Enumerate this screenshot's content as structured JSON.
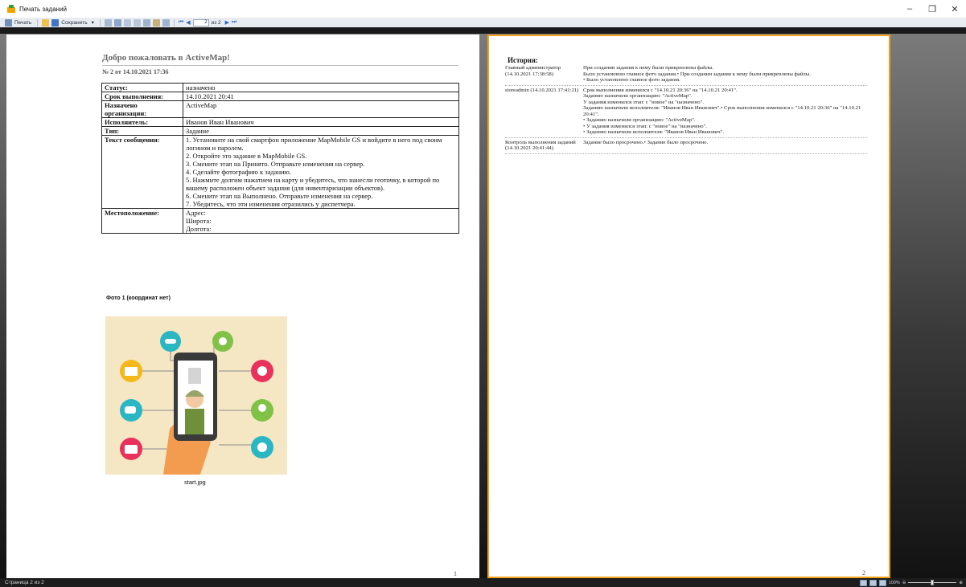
{
  "window": {
    "title": "Печать заданий",
    "controls": [
      "–",
      "❐",
      "✕"
    ]
  },
  "toolbar": {
    "print_label": "Печать",
    "save_label": "Сохранить",
    "dropdown_arrow": "▾",
    "current_page": "2",
    "page_of": "из 2"
  },
  "page1": {
    "title": "Добро пожаловать в ActiveMap!",
    "subtitle": "№ 2 от 14.10.2021 17:36",
    "rows": [
      {
        "label": "Статус:",
        "value": "назначено"
      },
      {
        "label": "Срок выполнения:",
        "value": "14.10.2021 20:41"
      },
      {
        "label": "Назначено организации:",
        "value": "ActiveMap"
      },
      {
        "label": "Исполнитель:",
        "value": "Иванов Иван Иванович"
      },
      {
        "label": "Тип:",
        "value": "Задание"
      },
      {
        "label": "Текст сообщения:",
        "lines": [
          "1. Установите на свой смартфон приложение MapMobile GS и войдите в него под своим логином и паролем.",
          "2. Откройте это задание в MapMobile GS.",
          "3. Смените этап на Принято. Отправьте изменения на сервер.",
          "4. Сделайте фотографию к заданию.",
          "5. Нажмите долгим нажатием на карту и убедитесь, что нанесли геоточку, в которой по вашему расположен объект задания (для инвентаризации объектов).",
          "6. Смените этап на Выполнено. Отправьте изменения на сервер.",
          "7. Убедитесь, что эти изменения отразились у диспетчера."
        ]
      },
      {
        "label": "Местоположение:",
        "lines": [
          "Адрес:",
          "Широта:",
          "Долгота:"
        ]
      }
    ],
    "photo_caption": "Фото 1 (координат нет)",
    "photo_filename": "start.jpg",
    "page_number": "1"
  },
  "page2": {
    "history_title": "История:",
    "entries": [
      {
        "author": "Главный администратор (14.10.2021 17:38:58)",
        "lines": [
          "При создании задания к нему были прикреплены файлы.",
          "Было установлено главное фото задания.• При создании задания к нему были прикреплены файлы.",
          "• Было установлено главное фото задания."
        ]
      },
      {
        "author": "storeadmin (14.10.2021 17:41:21)",
        "lines": [
          "Срок выполнения изменился с \"14.10.21 20:36\" на \"14.10.21 20:41\".",
          "Заданию назначили организацию: \"ActiveMap\".",
          "У задания изменился этап: с \"новое\" на \"назначено\".",
          "Заданию назначили исполнителя: \"Иванов Иван Иванович\".• Срок выполнения изменился с \"14.10.21 20:36\" на \"14.10.21 20:41\".",
          "• Заданию назначили организацию: \"ActiveMap\".",
          "• У задания изменился этап: с \"новое\" на \"назначено\".",
          "• Заданию назначили исполнителя: \"Иванов Иван Иванович\"."
        ]
      },
      {
        "author": "Контроль выполнения заданий (14.10.2021 20:41:44)",
        "lines": [
          "Задание было просрочено.• Задание было просрочено."
        ]
      }
    ],
    "page_number": "2"
  },
  "status": {
    "text": "Страница 2 из 2",
    "zoom": "100%",
    "zoom_level": 0.5
  },
  "colors": {
    "active_page_border": "#f0a11a",
    "title_text": "#666666"
  }
}
